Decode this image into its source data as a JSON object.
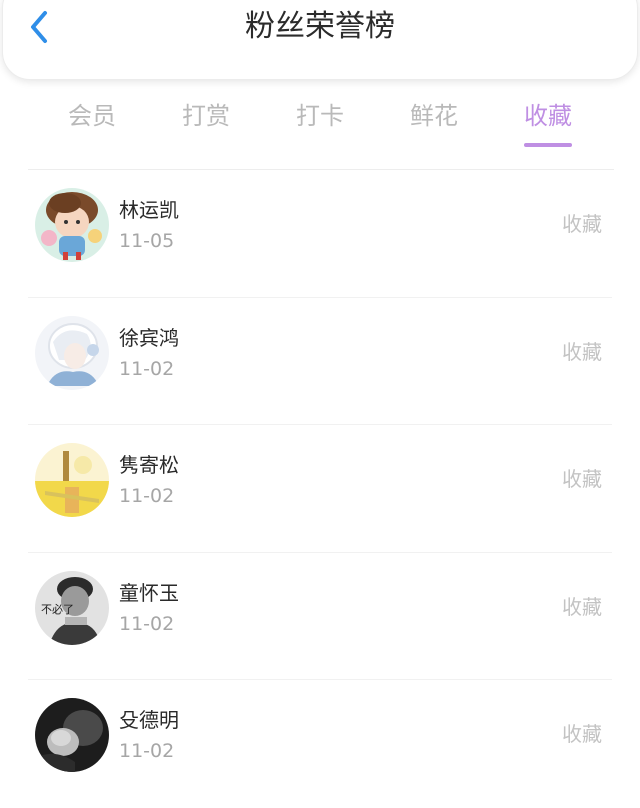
{
  "header": {
    "title": "粉丝荣誉榜",
    "back_icon": "chevron-left-icon",
    "accent_color": "#2f8ee8"
  },
  "tabs": {
    "items": [
      "会员",
      "打赏",
      "打卡",
      "鲜花",
      "收藏"
    ],
    "active": "收藏",
    "active_color": "#bf8fe3",
    "inactive_color": "#b9b9b9"
  },
  "fans": [
    {
      "name": "林运凯",
      "date": "11-05",
      "action": "收藏",
      "avatar": "cartoon-girl-avatar"
    },
    {
      "name": "徐宾鸿",
      "date": "11-02",
      "action": "收藏",
      "avatar": "anime-white-hair-avatar"
    },
    {
      "name": "隽寄松",
      "date": "11-02",
      "action": "收藏",
      "avatar": "yellow-photo-avatar"
    },
    {
      "name": "童怀玉",
      "date": "11-02",
      "action": "收藏",
      "avatar": "man-grayscale-avatar",
      "avatar_text": "不必了"
    },
    {
      "name": "殳德明",
      "date": "11-02",
      "action": "收藏",
      "avatar": "dark-photo-avatar"
    }
  ]
}
